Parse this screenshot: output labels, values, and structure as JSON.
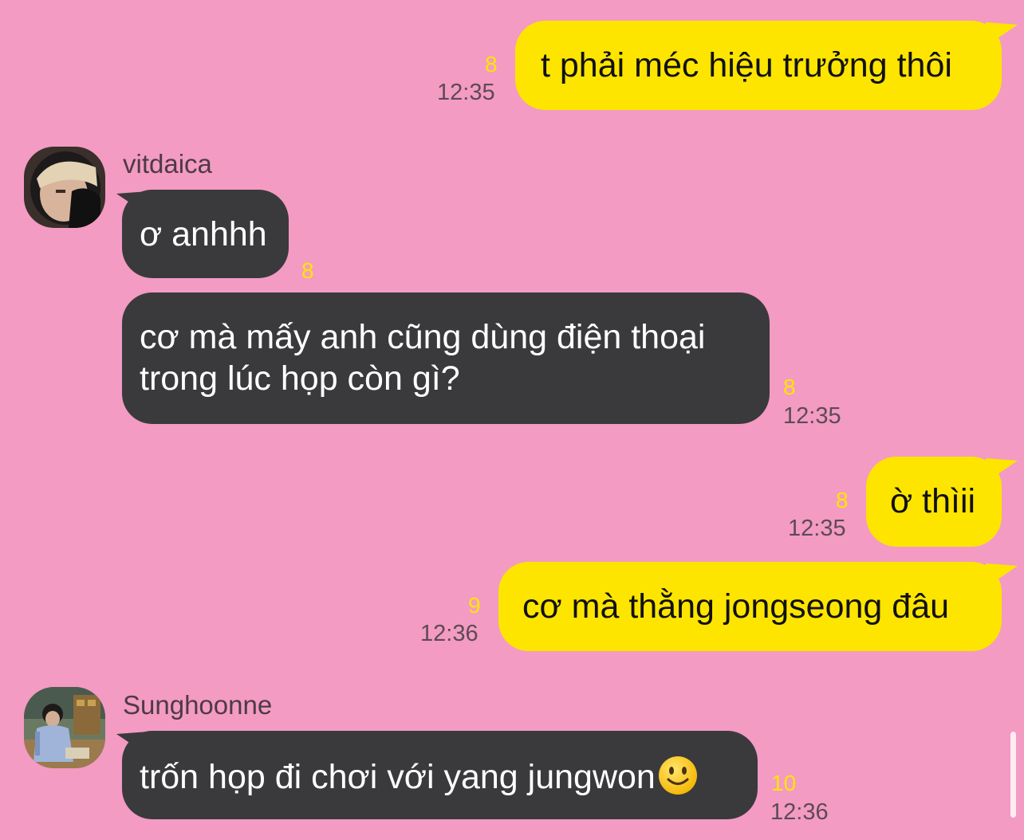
{
  "messages": [
    {
      "text": "t phải méc hiệu trưởng thôi",
      "unread": "8",
      "time": "12:35"
    },
    {
      "sender": "vitdaica",
      "text": "ơ anhhh",
      "unread": "8"
    },
    {
      "line1": "cơ mà mấy anh cũng dùng điện thoại",
      "line2": "trong lúc họp còn gì?",
      "unread": "8",
      "time": "12:35"
    },
    {
      "text": "ờ thìii",
      "unread": "8",
      "time": "12:35"
    },
    {
      "text": "cơ mà thằng jongseong đâu",
      "unread": "9",
      "time": "12:36"
    },
    {
      "sender": "Sunghoonne",
      "text": "trốn họp đi chơi với yang jungwon",
      "unread": "10",
      "time": "12:36"
    }
  ],
  "colors": {
    "background": "#f39bc3",
    "outgoing_bubble": "#fee500",
    "incoming_bubble": "#3a3a3c",
    "unread_count": "#fee500"
  },
  "icons": {
    "emoji": "slightly-smiling-face-icon",
    "avatar1": "avatar-vitdaica",
    "avatar2": "avatar-sunghoonne"
  }
}
